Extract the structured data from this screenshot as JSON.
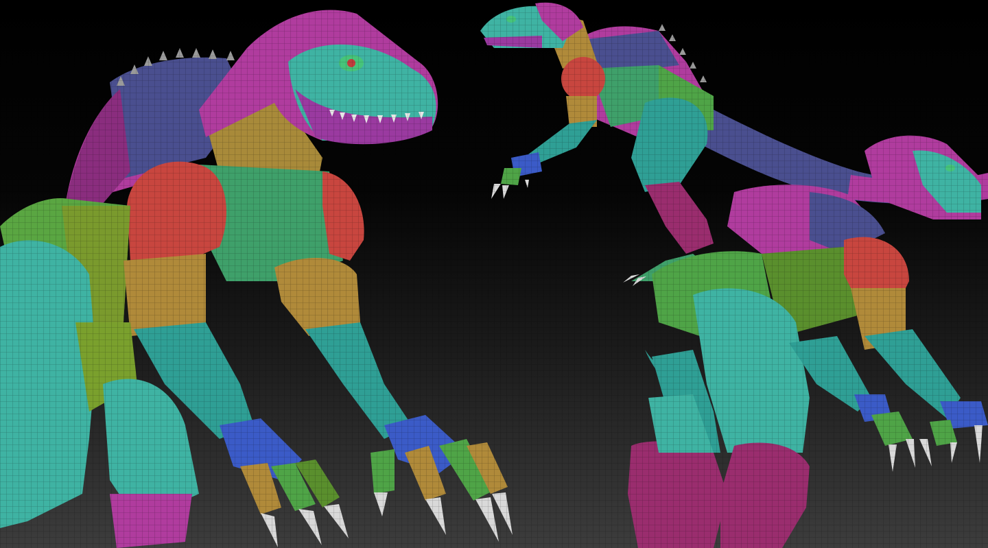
{
  "scene": {
    "subject": "polygroup-colored-dinosaur-sculpt",
    "views": [
      "front-three-quarter-view",
      "side-view-leaping",
      "rear-three-quarter-view"
    ],
    "palette": {
      "teal": "#3fb3a3",
      "teal_dark": "#2d8f86",
      "magenta": "#b03c9e",
      "magenta_dark": "#8a2d7e",
      "indigo": "#4a4f8f",
      "red": "#c8463f",
      "ochre": "#b08a3a",
      "green": "#4fa447",
      "olive": "#7a9a2d",
      "blue": "#3b5bc7",
      "claw": "#d9d9d9"
    }
  }
}
